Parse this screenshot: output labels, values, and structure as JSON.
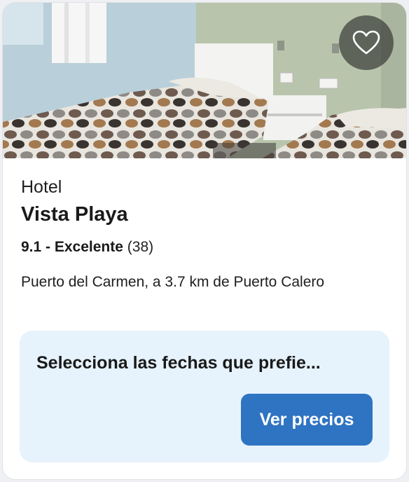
{
  "hotel": {
    "category": "Hotel",
    "name": "Vista Playa",
    "rating_score": "9.1 - Excelente",
    "rating_count": "(38)",
    "location": "Puerto del Carmen, a 3.7 km de Puerto Calero"
  },
  "cta": {
    "prompt": "Selecciona las fechas que prefie...",
    "button_label": "Ver precios"
  },
  "icons": {
    "favorite": "heart-outline-icon"
  },
  "colors": {
    "cta_background": "#e6f3fd",
    "button": "#2f74c2"
  }
}
